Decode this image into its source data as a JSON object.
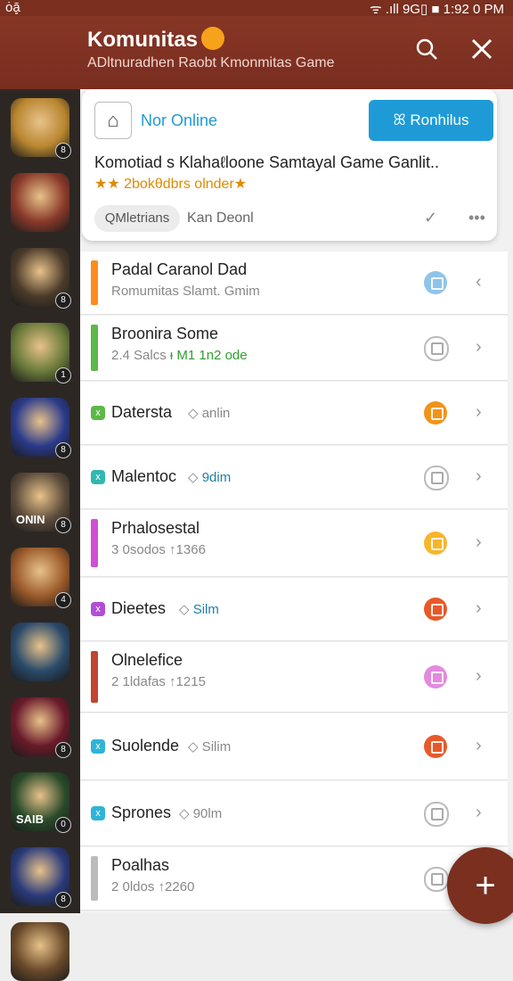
{
  "status_bar": {
    "left": "ȯḁ̄ ",
    "right": "ᯤ .ıll 9G▯ ■ 1:92 0 PM"
  },
  "header": {
    "title": "Komunitas",
    "subtitle": "ADltnuradhen Raobt Kmonmitas Game",
    "icons": [
      "search-icon",
      "close-icon"
    ]
  },
  "rail": {
    "avatars": [
      {
        "badge": "8",
        "initial": "",
        "color": "#b8862f"
      },
      {
        "badge": "",
        "initial": "",
        "color": "#8a3a2a"
      },
      {
        "badge": "8",
        "initial": "",
        "color": "#4a3a2a"
      },
      {
        "badge": "1",
        "initial": "",
        "color": "#6a7a3a"
      },
      {
        "badge": "8",
        "initial": "",
        "color": "#2a3a8a"
      },
      {
        "badge": "8",
        "initial": "ONIN",
        "color": "#5a4a3a"
      },
      {
        "badge": "4",
        "initial": "",
        "color": "#9a5a2a"
      },
      {
        "badge": "",
        "initial": "",
        "color": "#2a4a6a"
      },
      {
        "badge": "8",
        "initial": "",
        "color": "#6a1a2a"
      },
      {
        "badge": "0",
        "initial": "SAIB",
        "color": "#2a4a2a"
      },
      {
        "badge": "8",
        "initial": "",
        "color": "#2a3a7a"
      },
      {
        "badge": "",
        "initial": "",
        "color": "#6a4a2a"
      }
    ]
  },
  "card": {
    "online_label": "Nor Online",
    "button_label": "Ronhilus",
    "text": "Komotiad s Klahaℓloone Samtayal Game Ganlit..",
    "stars_text": "★★ 2bokθdbrs olnder★",
    "pill_label": "QMletrians",
    "more_label": "Kan Deonl",
    "check_icon": "check-icon",
    "dots_icon": "more-icon"
  },
  "list": [
    {
      "title": "Padal Caranol Dad",
      "sub": "Romumitas Slamt. Gmim",
      "sub_accent": "",
      "marker": "bar",
      "marker_color": "#ff8c1a",
      "icon_color": "#8fc4ea",
      "outline": false,
      "chev": "‹"
    },
    {
      "title": "Broonira Some",
      "sub": "2.4 Salcs ",
      "sub_accent": "ᵻ M1 1n2 ode",
      "marker": "bar",
      "marker_color": "#5cb848",
      "icon_color": "#bbbbbb",
      "outline": true,
      "chev": "›"
    },
    {
      "title": "Datersta",
      "sub": "◇ anlin",
      "sub_accent": "",
      "marker": "small",
      "marker_color": "#5cb848",
      "marker_text": "x",
      "icon_color": "#f0931a",
      "outline": false,
      "chev": "›"
    },
    {
      "title": "Malentoc",
      "sub": "◇ ",
      "sub_accent": "9dim",
      "marker": "small",
      "marker_color": "#30b8b0",
      "marker_text": "x",
      "icon_color": "#bbbbbb",
      "outline": true,
      "chev": "›"
    },
    {
      "title": "Prhalosestal",
      "sub": "3 0sodos ↑1366",
      "sub_accent": "",
      "marker": "bar",
      "marker_color": "#d04fd6",
      "icon_color": "#f7b52a",
      "outline": false,
      "chev": "›"
    },
    {
      "title": "Dieetes",
      "sub": "◇ ",
      "sub_accent": "Silm",
      "marker": "small",
      "marker_color": "#b04fd6",
      "marker_text": "x",
      "icon_color": "#e8592a",
      "outline": false,
      "chev": "›"
    },
    {
      "title": "Olnelefice",
      "sub": "2 1ldafas ↑1215",
      "sub_accent": "",
      "marker": "bar",
      "marker_color": "#c2452f",
      "icon_color": "#e28ae0",
      "outline": false,
      "chev": "›"
    },
    {
      "title": "Suolende",
      "sub": "◇ Silim",
      "sub_accent": "",
      "marker": "small",
      "marker_color": "#2fb4d8",
      "marker_text": "x",
      "icon_color": "#e8592a",
      "outline": false,
      "chev": "›"
    },
    {
      "title": "Sprones",
      "sub": "◇ 90lm",
      "sub_accent": "",
      "marker": "small",
      "marker_color": "#2fb4d8",
      "marker_text": "x",
      "icon_color": "#bbbbbb",
      "outline": true,
      "chev": "›"
    },
    {
      "title": "Poalhas",
      "sub": "2 0ldos ↑2260",
      "sub_accent": "",
      "marker": "bar",
      "marker_color": "#bbbbbb",
      "icon_color": "#bbbbbb",
      "outline": true,
      "chev": ""
    }
  ],
  "fab": {
    "label": "+"
  }
}
